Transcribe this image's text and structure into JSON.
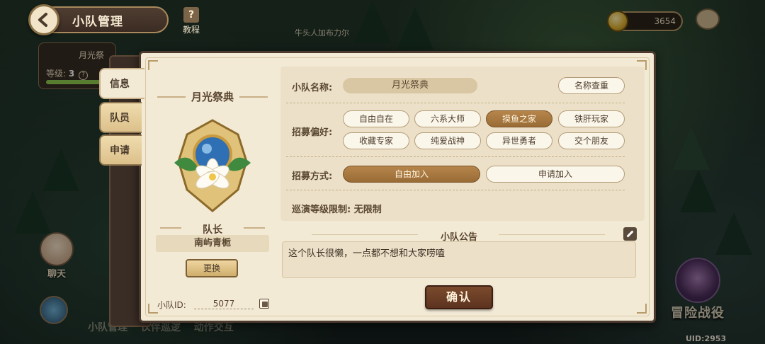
{
  "header": {
    "title": "小队管理",
    "tutorial_label": "教程",
    "npc_name": "牛头人加布力尔"
  },
  "currency": {
    "amount": "3654"
  },
  "background": {
    "team_card": {
      "name": "月光祭",
      "level_label": "等级:",
      "level_value": "3",
      "help": "?",
      "progress": 0.85
    },
    "chat_label": "聊天",
    "bottom_tabs": [
      "小队管理",
      "伙伴巡逻",
      "动作交互"
    ],
    "adventure_label": "冒险战役",
    "uid": "UID:2953"
  },
  "tabs": [
    {
      "label": "信息",
      "active": true
    },
    {
      "label": "队员",
      "active": false
    },
    {
      "label": "申请",
      "active": false
    }
  ],
  "team": {
    "title": "月光祭典",
    "captain_label": "队长",
    "captain_name": "南屿青栀",
    "change_button": "更换",
    "id_label": "小队ID:",
    "id_value": "5077"
  },
  "form": {
    "name_label": "小队名称:",
    "name_value": "月光祭典",
    "rename_button": "名称查重",
    "preference_label": "招募偏好:",
    "preferences": [
      {
        "label": "自由自在",
        "selected": false
      },
      {
        "label": "六系大师",
        "selected": false
      },
      {
        "label": "摸鱼之家",
        "selected": true
      },
      {
        "label": "铁肝玩家",
        "selected": false
      },
      {
        "label": "收藏专家",
        "selected": false
      },
      {
        "label": "纯爱战神",
        "selected": false
      },
      {
        "label": "异世勇者",
        "selected": false
      },
      {
        "label": "交个朋友",
        "selected": false
      }
    ],
    "method_label": "招募方式:",
    "methods": [
      {
        "label": "自由加入",
        "selected": true
      },
      {
        "label": "申请加入",
        "selected": false
      }
    ],
    "level_limit": "巡演等级限制: 无限制"
  },
  "announcement": {
    "title": "小队公告",
    "text": "这个队长很懒，一点都不想和大家唠嗑"
  },
  "confirm_label": "确认",
  "colors": {
    "accent": "#a8773e",
    "dialog_bg": "#f3ead6",
    "confirm": "#6b3e25"
  }
}
